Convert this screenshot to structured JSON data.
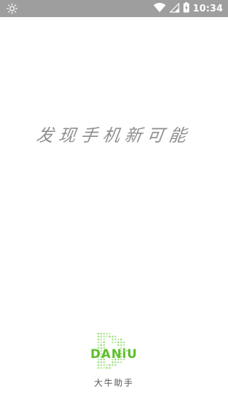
{
  "status_bar": {
    "time": "10:34",
    "background_color": "#9e9e9e",
    "icons": [
      "brightness-icon",
      "wifi-icon",
      "signal-icon",
      "battery-icon"
    ]
  },
  "splash": {
    "slogan": "发现手机新可能"
  },
  "brand": {
    "wordmark": "DANiU",
    "caption": "大牛助手",
    "accent_color": "#5cbf2a"
  }
}
